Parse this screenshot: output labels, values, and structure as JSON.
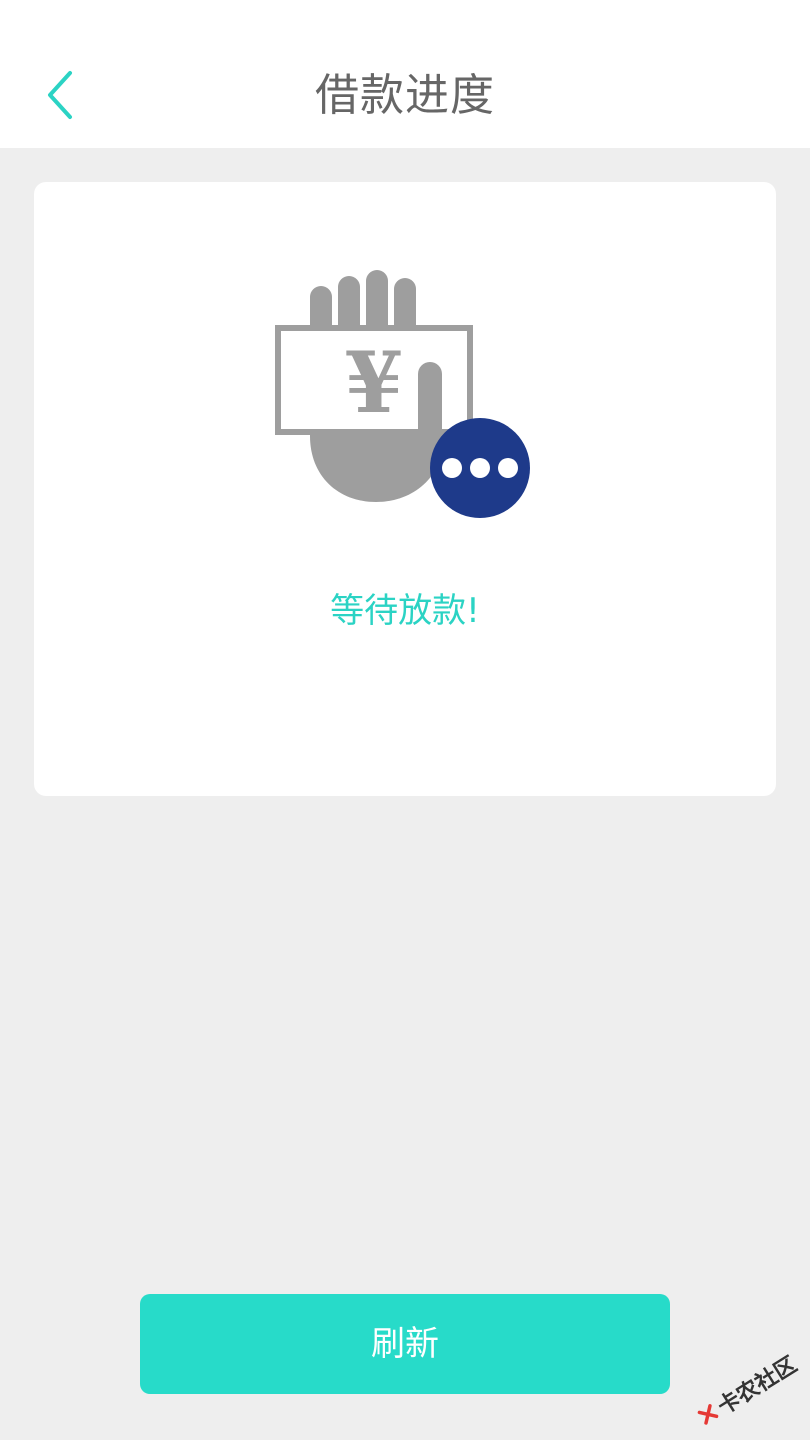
{
  "header": {
    "title": "借款进度",
    "back_icon": "chevron-left-icon"
  },
  "status": {
    "illustration_icon": "hand-holding-yuan-bill-icon",
    "badge_icon": "more-dots-icon",
    "message": "等待放款!"
  },
  "actions": {
    "refresh_label": "刷新"
  },
  "watermark": {
    "text": "卡农社区"
  },
  "colors": {
    "accent": "#2bd3c4",
    "button": "#27dbc9",
    "title_text": "#666666",
    "background": "#eeeeee",
    "card": "#ffffff",
    "illustration_gray": "#9e9e9e",
    "badge_blue": "#1e3a8a"
  }
}
